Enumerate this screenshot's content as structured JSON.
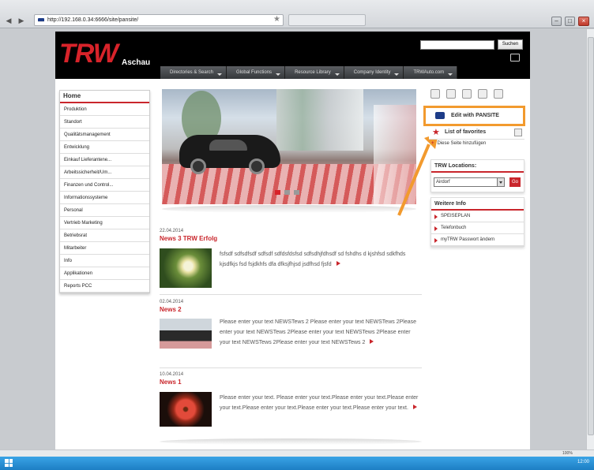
{
  "browser": {
    "url": "http://192.168.0.34:6666/site/pansite/",
    "zoom": "100%"
  },
  "header": {
    "logo": "TRW",
    "logo_sub": "Aschau",
    "search_button": "Suchen",
    "nav": [
      "Directories & Search",
      "Global Functions",
      "Resource Library",
      "Company Identity",
      "TRWAuto.com"
    ]
  },
  "sidebar": {
    "home": "Home",
    "items": [
      "Produktion",
      "Standort",
      "Qualitätsmanagement",
      "Entwicklung",
      "Einkauf Lieferantene...",
      "Arbeitssicherheit/Um...",
      "Finanzen und Control...",
      "Informationssysteme",
      "Personal",
      "Vertrieb Marketing",
      "Betriebsrat",
      "Mitarbeiter",
      "Info",
      "Applikationen",
      "Reports PCC"
    ]
  },
  "news": [
    {
      "date": "22.04.2014",
      "title": "News 3 TRW Erfolg",
      "text": "fsfsdf sdfsdfsdf sdfsdf sdfdsfdsfsd sdfsdhjfdhsdf sd fshdhs d kjshfsd sdkfhds kjsdfkjs fsd fsjdkhfs dfa dfksjfhjsd jsdfhsd fjsfd"
    },
    {
      "date": "02.04.2014",
      "title": "News 2",
      "text": "Please enter your text NEWSTews 2 Please enter your text NEWSTews 2Please enter your text NEWSTews 2Please enter your text NEWSTews 2Please enter your text NEWSTews 2Please enter your text NEWSTews 2"
    },
    {
      "date": "10.04.2014",
      "title": "News 1",
      "text": "Please enter your text. Please enter your text.Please enter your text.Please enter your text.Please enter your text.Please enter your text.Please enter your text."
    }
  ],
  "right": {
    "pansite_label": "Edit with PANSITE",
    "favorites_label": "List of favorites",
    "add_page": "Diese Seite hinzufügen",
    "locations_title": "TRW Locations:",
    "location_selected": "Airdorf",
    "go_label": "Go",
    "weitere_title": "Weitere Info",
    "weitere_links": [
      "SPEISEPLAN",
      "Telefonbuch",
      "myTRW Passwort ändern"
    ]
  },
  "taskbar": {
    "clock": "12:00"
  },
  "colors": {
    "brand_red": "#d8232a",
    "accent_orange": "#f29a2e",
    "taskbar_blue": "#1d7fc4"
  }
}
